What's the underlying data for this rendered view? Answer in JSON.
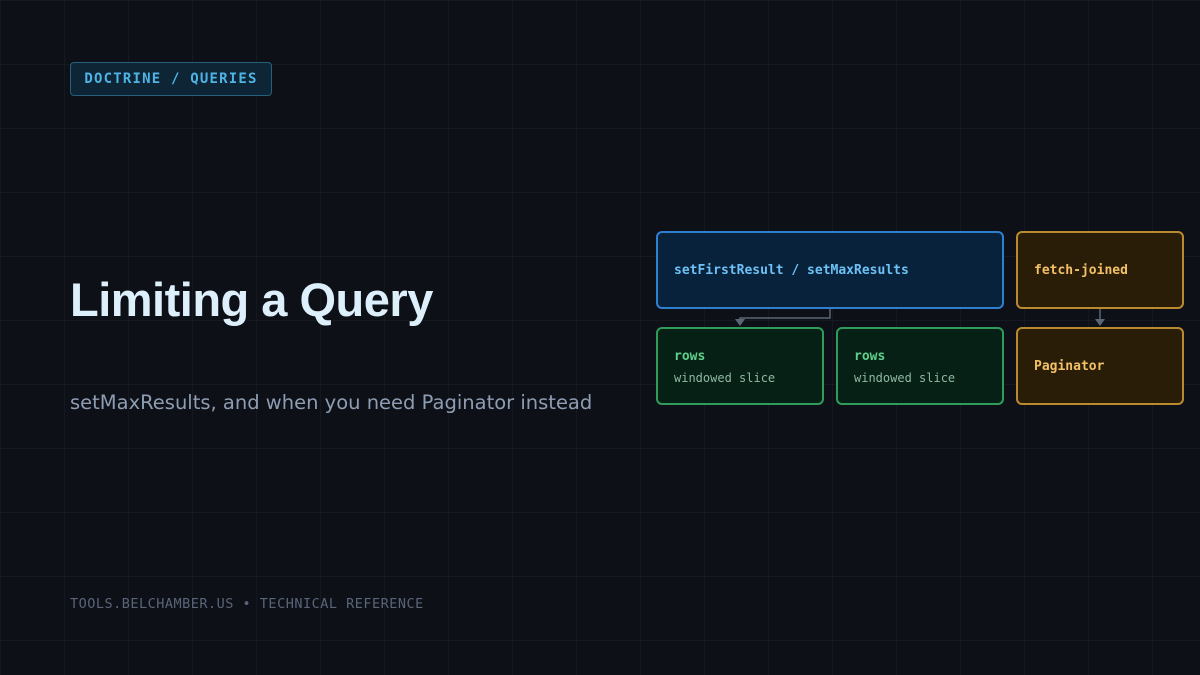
{
  "badge": "DOCTRINE / QUERIES",
  "title": "Limiting a Query",
  "subtitle": "setMaxResults, and when you need Paginator instead",
  "footer": "TOOLS.BELCHAMBER.US • TECHNICAL REFERENCE",
  "diagram": {
    "nodes": {
      "set_results": {
        "label": "setFirstResult / setMaxResults"
      },
      "rows_a": {
        "label": "rows",
        "sublabel": "windowed slice"
      },
      "rows_b": {
        "label": "rows",
        "sublabel": "windowed slice"
      },
      "fetch_joined": {
        "label": "fetch-joined"
      },
      "paginator": {
        "label": "Paginator"
      }
    },
    "colors": {
      "blue": "#2f7fd0",
      "green": "#2f9c5c",
      "amber": "#b98a2e",
      "connector": "#5b6575"
    }
  }
}
